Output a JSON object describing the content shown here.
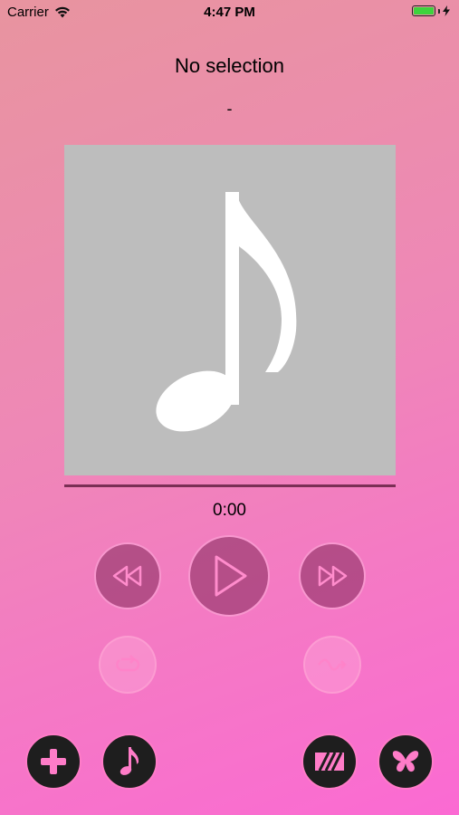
{
  "status_bar": {
    "carrier": "Carrier",
    "time": "4:47 PM",
    "battery_level": 1.0
  },
  "now_playing": {
    "title": "No selection",
    "artist": "-",
    "elapsed": "0:00",
    "progress": 0
  },
  "controls": {
    "rewind": "rewind-icon",
    "play": "play-icon",
    "fast_forward": "fast-forward-icon",
    "repeat": "repeat-icon",
    "effect": "wave-icon"
  },
  "toolbar": {
    "add": "plus-icon",
    "library": "music-note-icon",
    "visualizer": "stripes-icon",
    "theme": "butterfly-icon"
  },
  "colors": {
    "accent": "#ff7cc8",
    "bg_start": "#e8949f",
    "bg_end": "#fb6ad3",
    "artwork_bg": "#bdbdbd"
  }
}
